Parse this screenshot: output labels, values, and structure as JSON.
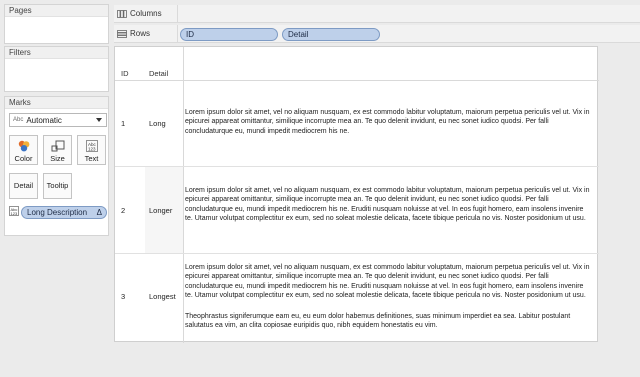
{
  "left_panel": {
    "pages_title": "Pages",
    "filters_title": "Filters",
    "marks_title": "Marks",
    "mark_type": {
      "prefix": "Abc",
      "value": "Automatic"
    },
    "buttons": {
      "color": "Color",
      "size": "Size",
      "text": "Text",
      "detail": "Detail",
      "tooltip": "Tooltip"
    },
    "field_pill": "Long Description",
    "field_pill_suffix": "Δ"
  },
  "shelves": {
    "columns_label": "Columns",
    "rows_label": "Rows",
    "rows_pills": [
      "ID",
      "Detail"
    ]
  },
  "table": {
    "headers": {
      "id": "ID",
      "detail": "Detail"
    },
    "rows": [
      {
        "id": "1",
        "detail": "Long",
        "text": "Lorem ipsum dolor sit amet, vel no aliquam nusquam, ex est commodo labitur voluptatum, maiorum perpetua periculis vel ut. Vix in epicurei appareat omittantur, similique incorrupte mea an. Te quo delenit invidunt, eu nec sonet iudico quodsi. Per falli concludaturque eu, mundi impedit mediocrem his ne."
      },
      {
        "id": "2",
        "detail": "Longer",
        "text": "Lorem ipsum dolor sit amet, vel no aliquam nusquam, ex est commodo labitur voluptatum, maiorum perpetua periculis vel ut. Vix in epicurei appareat omittantur, similique incorrupte mea an. Te quo delenit invidunt, eu nec sonet iudico quodsi. Per falli concludaturque eu, mundi impedit mediocrem his ne. Eruditi nusquam noluisse at vel. In eos fugit homero, eam insolens invenire te. Utamur volutpat complectitur ex eum, sed no soleat molestie delicata, facete tibique pericula no vis. Noster posidonium ut usu."
      },
      {
        "id": "3",
        "detail": "Longest",
        "text": "Lorem ipsum dolor sit amet, vel no aliquam nusquam, ex est commodo labitur voluptatum, maiorum perpetua periculis vel ut. Vix in epicurei appareat omittantur, similique incorrupte mea an. Te quo delenit invidunt, eu nec sonet iudico quodsi. Per falli concludaturque eu, mundi impedit mediocrem his ne. Eruditi nusquam noluisse at vel. In eos fugit homero, eam insolens invenire te. Utamur volutpat complectitur ex eum, sed no soleat molestie delicata, facete tibique pericula no vis. Noster posidonium ut usu.",
        "text2": "Theophrastus signiferumque eam eu, eu eum dolor habemus definitiones, suas minimum imperdiet ea sea. Labitur postulant salutatus ea vim, an clita copiosae euripidis quo, nibh equidem honestatis eu vim."
      }
    ]
  },
  "colors": {
    "pill_fill": "#bed0ea",
    "pill_border": "#7e9bc4"
  }
}
